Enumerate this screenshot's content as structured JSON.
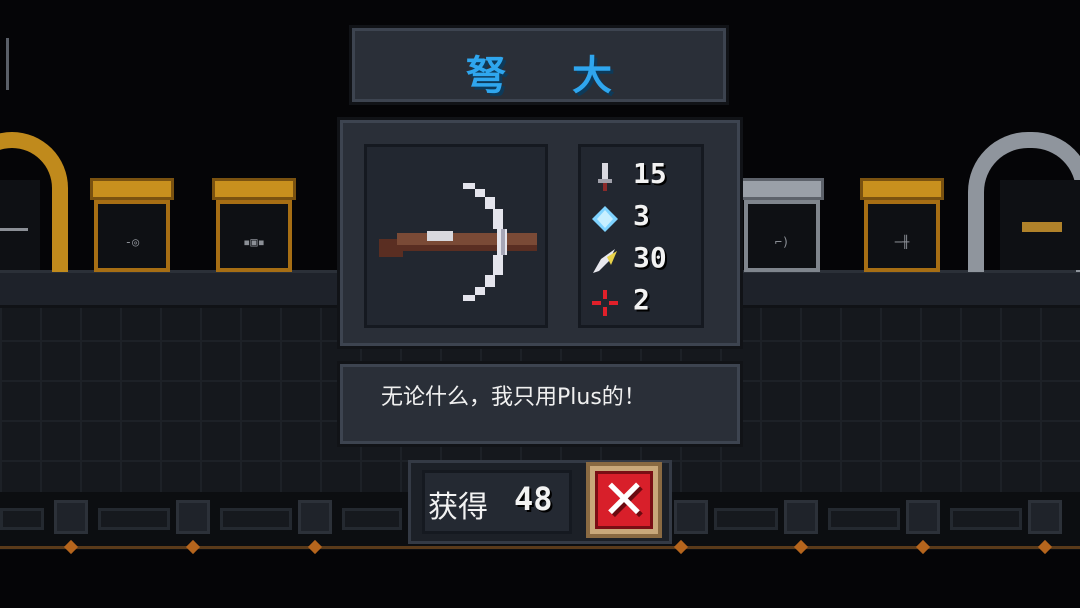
{
  "weapon": {
    "name": "弩 大",
    "icon": "crossbow-icon",
    "quote": "无论什么，我只用Plus的！"
  },
  "stats": [
    {
      "icon": "sword-damage-icon",
      "value": "15",
      "color": "#d9d9e0"
    },
    {
      "icon": "energy-crystal-icon",
      "value": "3",
      "color": "#7fd3ff"
    },
    {
      "icon": "critical-feather-icon",
      "value": "30",
      "color": "#e8d24a"
    },
    {
      "icon": "crosshair-accuracy-icon",
      "value": "2",
      "color": "#e0202a"
    }
  ],
  "obtain": {
    "label": "获得",
    "cost": "48"
  },
  "close": {
    "icon": "close-x-icon"
  },
  "colors": {
    "title": "#2fa6ee",
    "panel": "#2a2f38",
    "close_bg": "#d81f2a",
    "gold_case": "#c8901e",
    "silver_case": "#9aa0a8"
  }
}
